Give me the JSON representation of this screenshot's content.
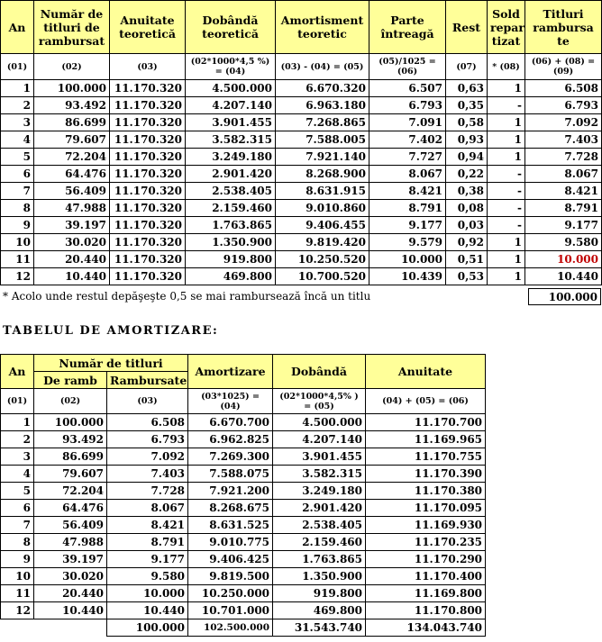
{
  "table1": {
    "headers": [
      "An",
      "Număr de titluri de rambursat",
      "Anuitate teoretică",
      "Dobândă teoretică",
      "Amortisment teoretic",
      "Parte întreagă",
      "Rest",
      "Sold repar tizat",
      "Titluri rambursa te"
    ],
    "codes": [
      "(01)",
      "(02)",
      "(03)",
      "(02*1000*4,5 %) = (04)",
      "(03) - (04) = (05)",
      "(05)/1025 = (06)",
      "(07)",
      "* (08)",
      "(06) + (08) = (09)"
    ],
    "rows": [
      [
        "1",
        "100.000",
        "11.170.320",
        "4.500.000",
        "6.670.320",
        "6.507",
        "0,63",
        "1",
        "6.508"
      ],
      [
        "2",
        "93.492",
        "11.170.320",
        "4.207.140",
        "6.963.180",
        "6.793",
        "0,35",
        "-",
        "6.793"
      ],
      [
        "3",
        "86.699",
        "11.170.320",
        "3.901.455",
        "7.268.865",
        "7.091",
        "0,58",
        "1",
        "7.092"
      ],
      [
        "4",
        "79.607",
        "11.170.320",
        "3.582.315",
        "7.588.005",
        "7.402",
        "0,93",
        "1",
        "7.403"
      ],
      [
        "5",
        "72.204",
        "11.170.320",
        "3.249.180",
        "7.921.140",
        "7.727",
        "0,94",
        "1",
        "7.728"
      ],
      [
        "6",
        "64.476",
        "11.170.320",
        "2.901.420",
        "8.268.900",
        "8.067",
        "0,22",
        "-",
        "8.067"
      ],
      [
        "7",
        "56.409",
        "11.170.320",
        "2.538.405",
        "8.631.915",
        "8.421",
        "0,38",
        "-",
        "8.421"
      ],
      [
        "8",
        "47.988",
        "11.170.320",
        "2.159.460",
        "9.010.860",
        "8.791",
        "0,08",
        "-",
        "8.791"
      ],
      [
        "9",
        "39.197",
        "11.170.320",
        "1.763.865",
        "9.406.455",
        "9.177",
        "0,03",
        "-",
        "9.177"
      ],
      [
        "10",
        "30.020",
        "11.170.320",
        "1.350.900",
        "9.819.420",
        "9.579",
        "0,92",
        "1",
        "9.580"
      ],
      [
        "11",
        "20.440",
        "11.170.320",
        "919.800",
        "10.250.520",
        "10.000",
        "0,51",
        "1",
        "10.000"
      ],
      [
        "12",
        "10.440",
        "11.170.320",
        "469.800",
        "10.700.520",
        "10.439",
        "0,53",
        "1",
        "10.440"
      ]
    ],
    "total": "100.000",
    "note": "* Acolo unde restul depăşeşte 0,5 se mai rambursează încă un titlu"
  },
  "section_title": "TABELUL DE AMORTIZARE:",
  "table2": {
    "headers": {
      "an": "An",
      "group": "Număr de titluri",
      "de_ramb": "De ramb",
      "rambursate": "Rambursate",
      "amortizare": "Amortizare",
      "dobanda": "Dobândă",
      "anuitate": "Anuitate"
    },
    "codes": [
      "(01)",
      "(02)",
      "(03)",
      "(03*1025) = (04)",
      "(02*1000*4,5% ) = (05)",
      "(04) + (05) = (06)"
    ],
    "rows": [
      [
        "1",
        "100.000",
        "6.508",
        "6.670.700",
        "4.500.000",
        "11.170.700"
      ],
      [
        "2",
        "93.492",
        "6.793",
        "6.962.825",
        "4.207.140",
        "11.169.965"
      ],
      [
        "3",
        "86.699",
        "7.092",
        "7.269.300",
        "3.901.455",
        "11.170.755"
      ],
      [
        "4",
        "79.607",
        "7.403",
        "7.588.075",
        "3.582.315",
        "11.170.390"
      ],
      [
        "5",
        "72.204",
        "7.728",
        "7.921.200",
        "3.249.180",
        "11.170.380"
      ],
      [
        "6",
        "64.476",
        "8.067",
        "8.268.675",
        "2.901.420",
        "11.170.095"
      ],
      [
        "7",
        "56.409",
        "8.421",
        "8.631.525",
        "2.538.405",
        "11.169.930"
      ],
      [
        "8",
        "47.988",
        "8.791",
        "9.010.775",
        "2.159.460",
        "11.170.235"
      ],
      [
        "9",
        "39.197",
        "9.177",
        "9.406.425",
        "1.763.865",
        "11.170.290"
      ],
      [
        "10",
        "30.020",
        "9.580",
        "9.819.500",
        "1.350.900",
        "11.170.400"
      ],
      [
        "11",
        "20.440",
        "10.000",
        "10.250.000",
        "919.800",
        "11.169.800"
      ],
      [
        "12",
        "10.440",
        "10.440",
        "10.701.000",
        "469.800",
        "11.170.800"
      ]
    ],
    "totals": [
      "100.000",
      "102.500.000",
      "31.543.740",
      "134.043.740"
    ]
  },
  "colors": {
    "header_bg": "#ffff99",
    "highlight": "#c00000"
  }
}
